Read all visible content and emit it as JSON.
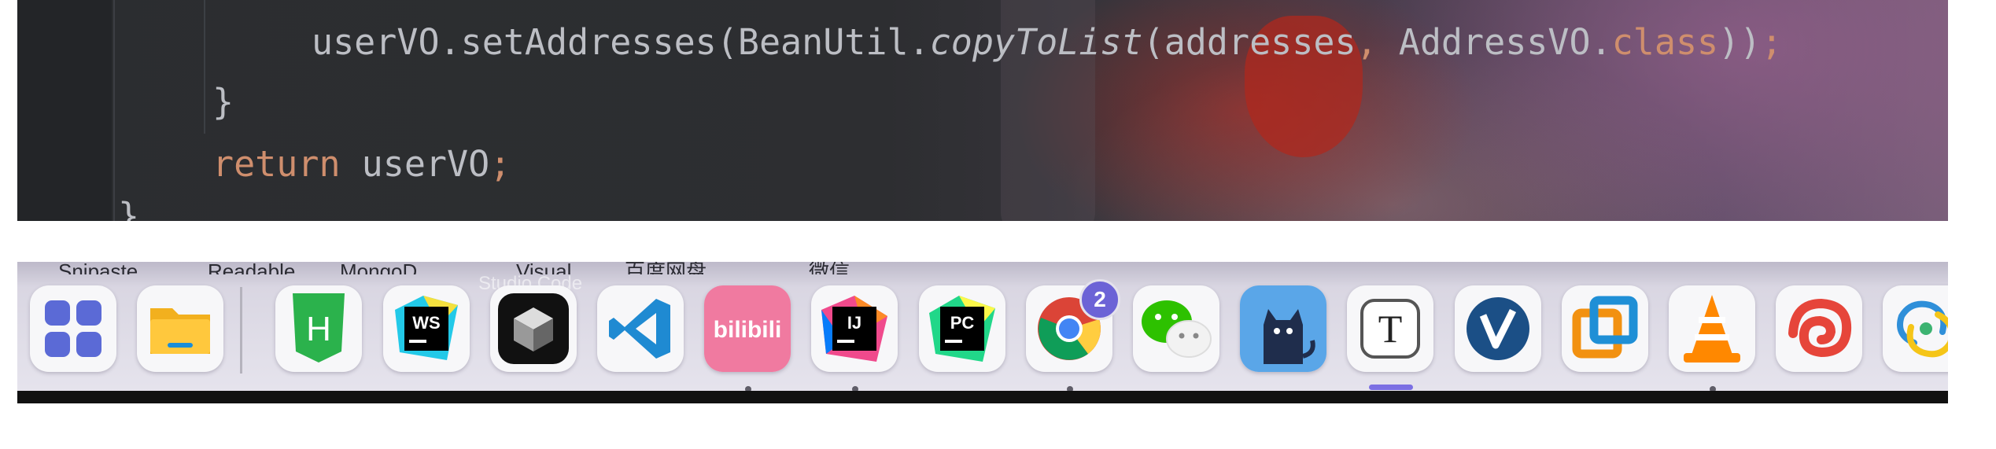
{
  "editor": {
    "lines": [
      {
        "parts": [
          {
            "t": "userVO.setAddresses(BeanUtil.",
            "c": "plain"
          },
          {
            "t": "copyToList",
            "c": "italic"
          },
          {
            "t": "(addresses",
            "c": "plain"
          },
          {
            "t": ", ",
            "c": "kw"
          },
          {
            "t": "AddressVO.",
            "c": "plain"
          },
          {
            "t": "class",
            "c": "kw"
          },
          {
            "t": "))",
            "c": "plain"
          },
          {
            "t": ";",
            "c": "kw"
          }
        ]
      },
      {
        "parts": [
          {
            "t": "}",
            "c": "plain"
          }
        ]
      },
      {
        "parts": [
          {
            "t": "return ",
            "c": "kw"
          },
          {
            "t": "userVO",
            "c": "plain"
          },
          {
            "t": ";",
            "c": "kw"
          }
        ]
      },
      {
        "parts": [
          {
            "t": "}",
            "c": "plain"
          }
        ]
      }
    ],
    "colors": {
      "text": "#bcbec4",
      "keyword": "#cf8e6d"
    }
  },
  "dock": {
    "strip_labels": [
      "Snipaste",
      "Readable",
      "MongoD...",
      "Visual",
      "百度网盘",
      "微信"
    ],
    "sublabel": "Studio Code",
    "badge_count": "2",
    "apps": [
      {
        "icon": "launchpad-icon",
        "name": "launchpad",
        "running": false,
        "active": false
      },
      {
        "icon": "folder-icon",
        "name": "file-manager",
        "running": false,
        "active": false
      },
      {
        "icon": "hbuilder-icon",
        "name": "hbuilder",
        "running": false,
        "active": false
      },
      {
        "icon": "webstorm-icon",
        "name": "webstorm",
        "running": false,
        "active": false
      },
      {
        "icon": "cube-icon",
        "name": "cube-app",
        "running": false,
        "active": false
      },
      {
        "icon": "vscode-icon",
        "name": "vscode",
        "running": false,
        "active": false
      },
      {
        "icon": "bilibili-icon",
        "name": "bilibili",
        "running": true,
        "active": false
      },
      {
        "icon": "intellij-icon",
        "name": "intellij-idea",
        "running": true,
        "active": false
      },
      {
        "icon": "pycharm-icon",
        "name": "pycharm",
        "running": false,
        "active": false
      },
      {
        "icon": "chrome-icon",
        "name": "chrome",
        "running": true,
        "active": false,
        "badge": true
      },
      {
        "icon": "wechat-icon",
        "name": "wechat",
        "running": false,
        "active": false
      },
      {
        "icon": "cat-icon",
        "name": "cat-app",
        "running": false,
        "active": false
      },
      {
        "icon": "typora-icon",
        "name": "typora",
        "running": false,
        "active": true
      },
      {
        "icon": "v-icon",
        "name": "v-app",
        "running": false,
        "active": false
      },
      {
        "icon": "vmware-icon",
        "name": "vmware",
        "running": false,
        "active": false
      },
      {
        "icon": "vlc-icon",
        "name": "vlc",
        "running": true,
        "active": false
      },
      {
        "icon": "swirl-icon",
        "name": "swirl-app",
        "running": false,
        "active": false
      },
      {
        "icon": "rings-icon",
        "name": "rings-app",
        "running": false,
        "active": false
      }
    ]
  }
}
